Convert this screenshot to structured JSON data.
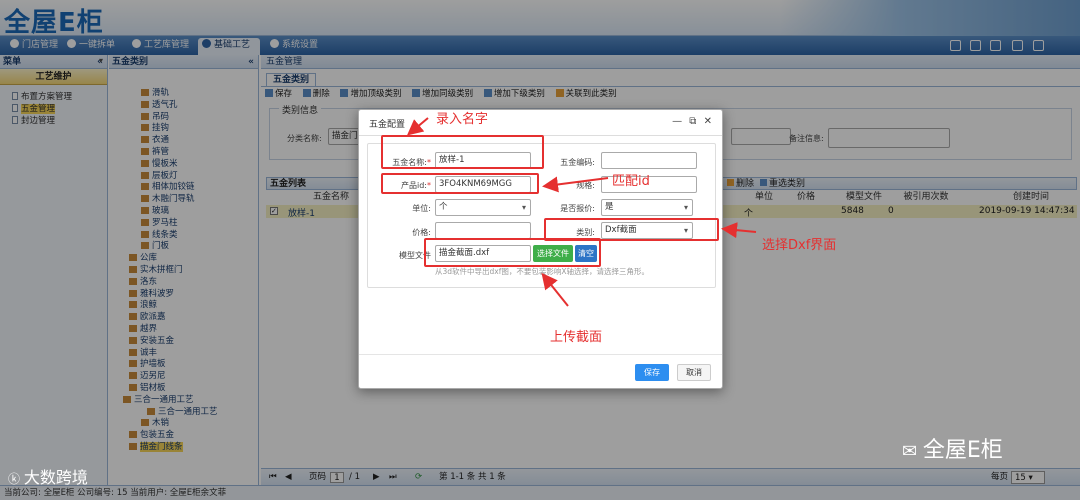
{
  "header": {
    "logo": "全屋E柜"
  },
  "nav": {
    "tabs": [
      "门店管理",
      "一键拆单",
      "工艺库管理",
      "基础工艺",
      "系统设置"
    ],
    "active_index": 3
  },
  "sidebar": {
    "title": "菜单",
    "section": "工艺维护",
    "items": [
      "布置方案管理",
      "五金管理",
      "封边管理"
    ],
    "selected_index": 1
  },
  "tree": {
    "title": "五金类别",
    "nodes": [
      "滑轨",
      "透气孔",
      "吊码",
      "挂钩",
      "衣通",
      "裤管",
      "慢板米",
      "层板灯",
      "相体加铰链",
      "木融门导轨",
      "玻璃",
      "罗马柱",
      "线条类",
      "门板",
      "公库",
      "实木拼框门",
      "洛东",
      "雅科波罗",
      "浪鲸",
      "欧派嘉",
      "越界",
      "安装五金",
      "诚丰",
      "护墙板",
      "迈另尼",
      "铝材板",
      "三合一通用工艺",
      "三合一通用工艺",
      "木销",
      "包装五金",
      "描金门线条"
    ]
  },
  "main": {
    "breadcrumb": "五金管理",
    "subtab": "五金类别",
    "toolbar": [
      "保存",
      "删除",
      "增加顶级类别",
      "增加同级类别",
      "增加下级类别",
      "关联到此类别"
    ],
    "fieldset_title": "类别信息",
    "category_label": "分类名称:",
    "category_value": "描金门",
    "remark_label": "备注信息:",
    "list_title": "五金列表",
    "list_actions": [
      "删除",
      "重选类别"
    ],
    "columns": [
      "五金名称",
      "单位",
      "价格",
      "模型文件",
      "被引用次数",
      "创建时间"
    ],
    "row": {
      "name": "放样-1",
      "unit": "个",
      "model": "5848",
      "refs": "0",
      "created": "2019-09-19 14:47:34"
    },
    "pager": {
      "page_label": "页码",
      "page": "1",
      "total": "/ 1",
      "summary": "第 1-1 条  共 1 条",
      "per_page_label": "每页",
      "per_page": "15"
    }
  },
  "statusbar": "当前公司: 全屋E柜  公司编号: 15  当前用户: 全屋E柜余文菲",
  "modal": {
    "title": "五金配置",
    "name_label": "五金名称:",
    "name_value": "放样-1",
    "code_label": "五金编码:",
    "code_value": "",
    "pid_label": "产品id:",
    "pid_value": "3FO4KNM69MGG",
    "spec_label": "规格:",
    "unit_label": "单位:",
    "unit_value": "个",
    "quote_label": "是否报价:",
    "quote_value": "是",
    "price_label": "价格:",
    "type_label": "类别:",
    "type_value": "Dxf截面",
    "model_label": "模型文件",
    "model_value": "描金截面.dxf",
    "choose_btn": "选择文件",
    "clear_btn": "清空",
    "hint": "从3d软件中导出dxf图，不要包装影响X轴选择，请选择三角形。",
    "save_btn": "保存",
    "cancel_btn": "取消"
  },
  "annotations": {
    "enter_name": "录入名字",
    "match_id": "匹配id",
    "choose_dxf": "选择Dxf界面",
    "upload": "上传截面"
  },
  "watermarks": {
    "left": "大数跨境",
    "right": "全屋E柜"
  },
  "colors": {
    "accent": "#2e64a6",
    "annotation": "#e53030",
    "selected_row": "#f5f0c4",
    "save_button": "#2d8ef0"
  }
}
